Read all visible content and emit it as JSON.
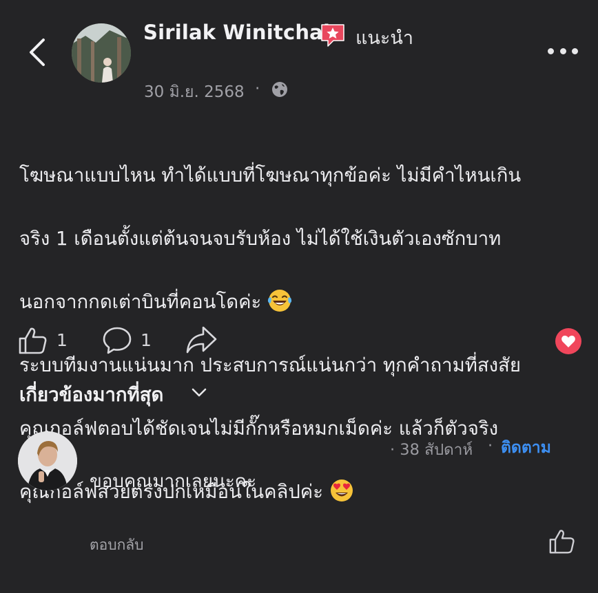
{
  "header": {
    "author_name": "Sirilak Winitchai",
    "badge_label": "แนะนำ",
    "date": "30 มิ.ย. 2568",
    "separator": "·",
    "icons": {
      "back": "chevron-left-icon",
      "badge": "recommend-star-badge-icon",
      "privacy": "globe-icon",
      "more": "more-dots-icon"
    }
  },
  "post": {
    "text_lines": [
      "โฆษณาแบบไหน ทำได้แบบที่โฆษณาทุกข้อค่ะ ไม่มีคำไหนเกิน",
      "จริง 1 เดือนตั้งแต่ต้นจนจบรับห้อง ไม่ได้ใช้เงินตัวเองซักบาท",
      "นอกจากกดเต่าบินที่คอนโดค่ะ",
      "ระบบทีมงานแน่นมาก ประสบการณ์แน่นกว่า ทุกคำถามที่สงสัย",
      "คุณกอล์ฟตอบได้ชัดเจนไม่มีกั๊กหรือหมกเม็ดค่ะ แล้วก็ตัวจริง",
      "คุณกอล์ฟสวยตรงปกเหมือนในคลิปค่ะ"
    ],
    "emoji_1": "laughing-tears-emoji",
    "emoji_2": "heart-eyes-emoji"
  },
  "actions": {
    "like_count": "1",
    "comment_count": "1",
    "reaction": "love-reaction-icon"
  },
  "comments_section": {
    "sort_label": "เกี่ยวข้องมากที่สุด"
  },
  "comment": {
    "meta": "· 38 สัปดาห์",
    "dot": "·",
    "follow_label": "ติดตาม",
    "text": "ขอบคุณมากเลยนะคะ",
    "reply_label": "ตอบกลับ"
  },
  "colors": {
    "background": "#242426",
    "follow": "#3d8ff2",
    "badge": "#e8475d",
    "heart": "#f0465b"
  }
}
